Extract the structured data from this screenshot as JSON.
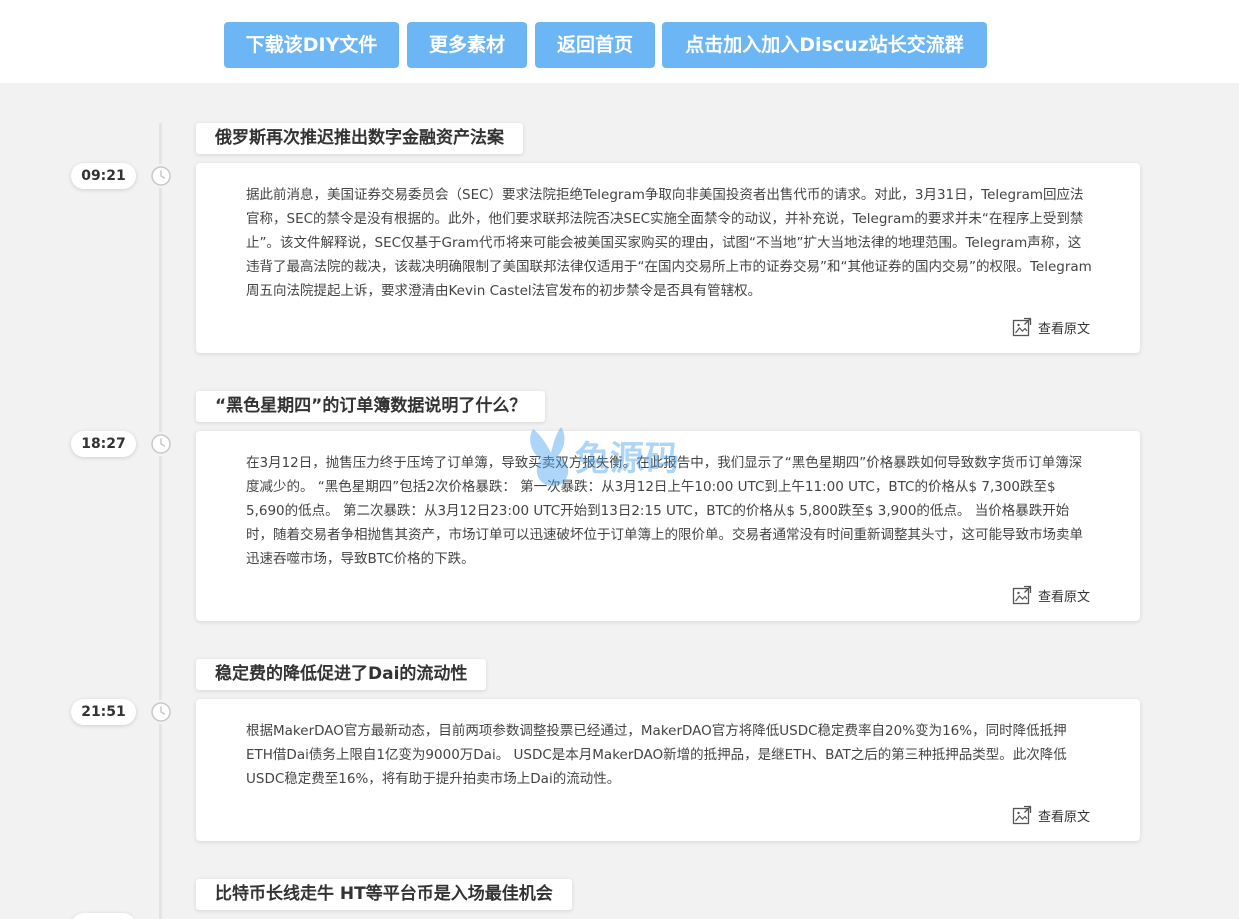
{
  "toolbar": {
    "buttons": [
      {
        "label": "下载该DIY文件"
      },
      {
        "label": "更多素材"
      },
      {
        "label": "返回首页"
      },
      {
        "label": "点击加入加入Discuz站长交流群"
      }
    ]
  },
  "entries": [
    {
      "time": "09:21",
      "title": "俄罗斯再次推迟推出数字金融资产法案",
      "body": "据此前消息，美国证券交易委员会（SEC）要求法院拒绝Telegram争取向非美国投资者出售代币的请求。对此，3月31日，Telegram回应法官称，SEC的禁令是没有根据的。此外，他们要求联邦法院否决SEC实施全面禁令的动议，并补充说，Telegram的要求并未“在程序上受到禁止”。该文件解释说，SEC仅基于Gram代币将来可能会被美国买家购买的理由，试图“不当地”扩大当地法律的地理范围。Telegram声称，这违背了最高法院的裁决，该裁决明确限制了美国联邦法律仅适用于“在国内交易所上市的证券交易”和“其他证券的国内交易”的权限。Telegram周五向法院提起上诉，要求澄清由Kevin Castel法官发布的初步禁令是否具有管辖权。",
      "link": "查看原文"
    },
    {
      "time": "18:27",
      "title": "“黑色星期四”的订单簿数据说明了什么？",
      "body": "在3月12日，抛售压力终于压垮了订单簿，导致买卖双方报失衡。在此报告中，我们显示了“黑色星期四”价格暴跌如何导致数字货币订单簿深度减少的。 “黑色星期四”包括2次价格暴跌： 第一次暴跌：从3月12日上午10:00 UTC到上午11:00 UTC，BTC的价格从$ 7,300跌至$ 5,690的低点。 第二次暴跌：从3月12日23:00 UTC开始到13日2:15 UTC，BTC的价格从$ 5,800跌至$ 3,900的低点。 当价格暴跌开始时，随着交易者争相抛售其资产，市场订单可以迅速破坏位于订单簿上的限价单。交易者通常没有时间重新调整其头寸，这可能导致市场卖单迅速吞噬市场，导致BTC价格的下跌。",
      "link": "查看原文"
    },
    {
      "time": "21:51",
      "title": "稳定费的降低促进了Dai的流动性",
      "body": "根据MakerDAO官方最新动态，目前两项参数调整投票已经通过，MakerDAO官方将降低USDC稳定费率自20%变为16%，同时降低抵押ETH借Dai债务上限自1亿变为9000万Dai。 USDC是本月MakerDAO新增的抵押品，是继ETH、BAT之后的第三种抵押品类型。此次降低USDC稳定费至16%，将有助于提升拍卖市场上Dai的流动性。",
      "link": "查看原文"
    },
    {
      "title": "比特币长线走牛 HT等平台币是入场最佳机会"
    }
  ],
  "watermark": {
    "text": "兔源码"
  },
  "colors": {
    "button": "#6cb6f5",
    "background": "#f2f2f2"
  }
}
